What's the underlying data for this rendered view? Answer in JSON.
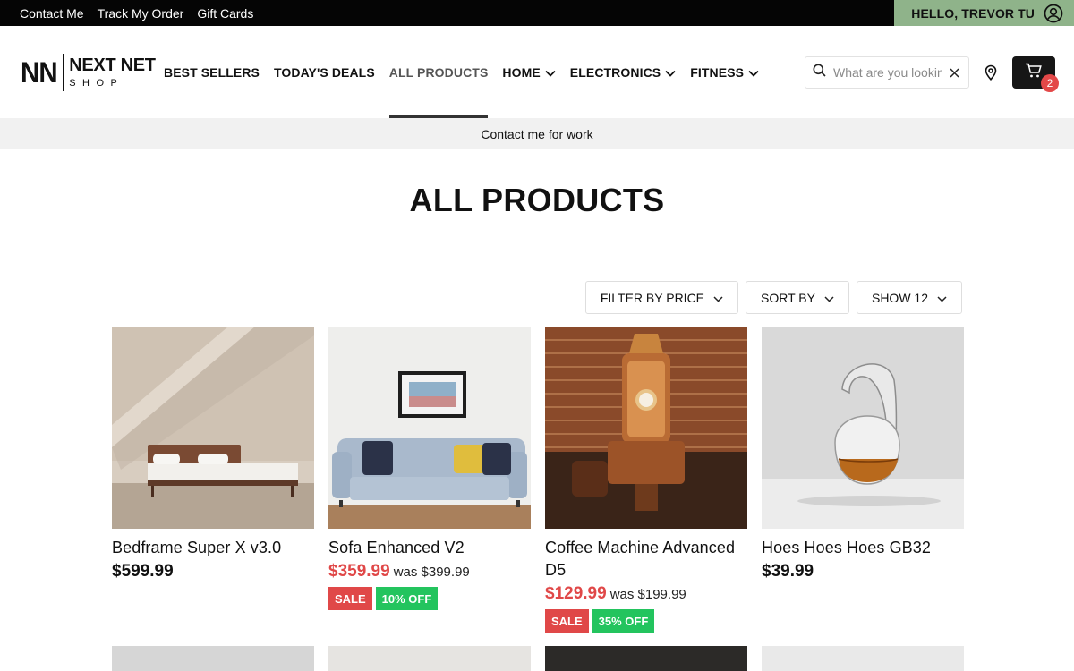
{
  "topbar": {
    "links": [
      "Contact Me",
      "Track My Order",
      "Gift Cards"
    ],
    "greeting": "HELLO, TREVOR TU"
  },
  "logo": {
    "mark": "NN",
    "name": "NEXT NET",
    "sub": "SHOP"
  },
  "nav": {
    "items": [
      {
        "label": "BEST SELLERS"
      },
      {
        "label": "TODAY'S DEALS"
      },
      {
        "label": "ALL PRODUCTS"
      },
      {
        "label": "HOME"
      },
      {
        "label": "ELECTRONICS"
      },
      {
        "label": "FITNESS"
      }
    ]
  },
  "search": {
    "placeholder": "What are you looking for?"
  },
  "cart": {
    "count": "2"
  },
  "announcement": "Contact me for work",
  "page": {
    "title": "ALL PRODUCTS"
  },
  "filters": {
    "price": "FILTER BY PRICE",
    "sort": "SORT BY",
    "show": "SHOW 12"
  },
  "products": [
    {
      "name": "Bedframe Super X v3.0",
      "price": "$599.99"
    },
    {
      "name": "Sofa Enhanced V2",
      "price": "$359.99",
      "was": "was $399.99",
      "sale_label": "SALE",
      "discount": "10% OFF"
    },
    {
      "name": "Coffee Machine Advanced D5",
      "price": "$129.99",
      "was": "was $199.99",
      "sale_label": "SALE",
      "discount": "35% OFF"
    },
    {
      "name": "Hoes Hoes Hoes GB32",
      "price": "$39.99"
    }
  ],
  "colors": {
    "accent_green": "#8fb38a",
    "sale_red": "#e04848",
    "discount_green": "#23c45e",
    "topbar": "#050505"
  }
}
